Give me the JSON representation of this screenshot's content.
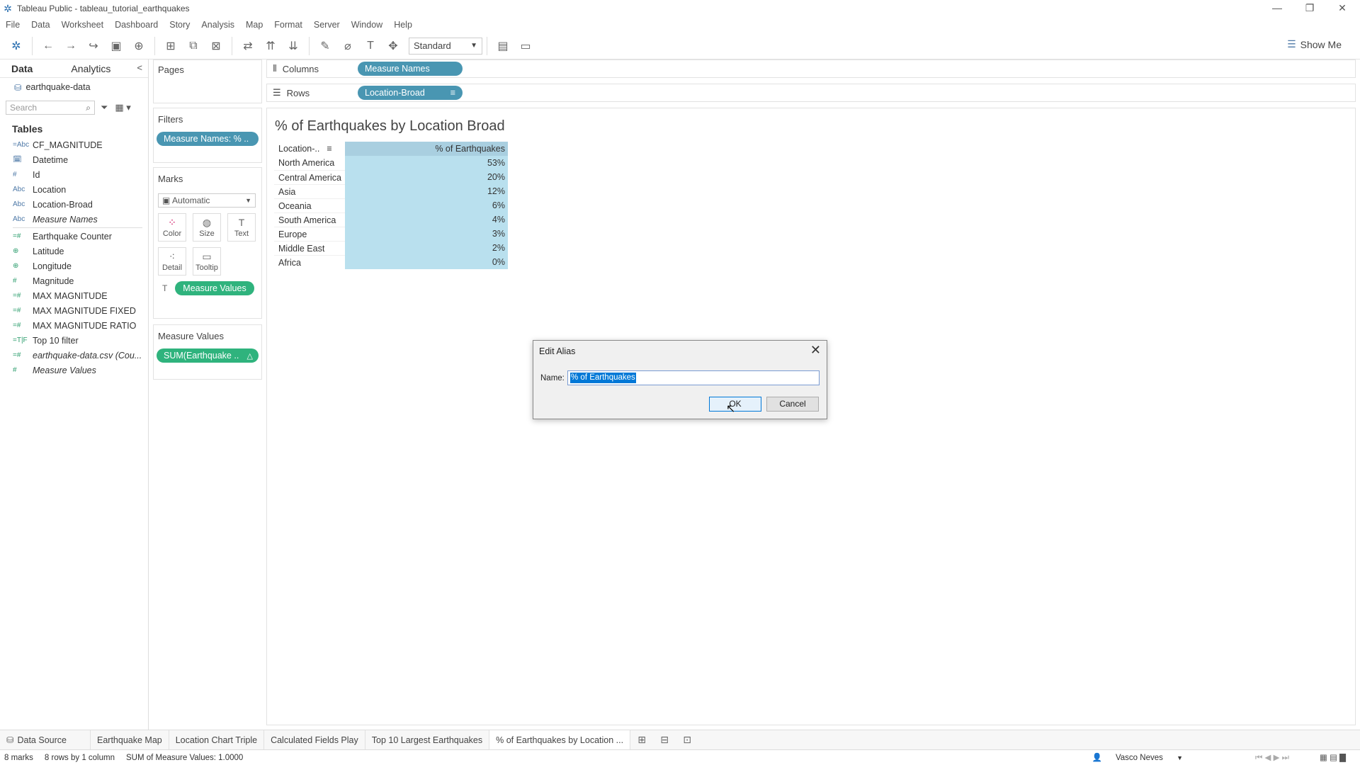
{
  "window": {
    "title": "Tableau Public - tableau_tutorial_earthquakes"
  },
  "menu": [
    "File",
    "Data",
    "Worksheet",
    "Dashboard",
    "Story",
    "Analysis",
    "Map",
    "Format",
    "Server",
    "Window",
    "Help"
  ],
  "toolbar": {
    "fit_label": "Standard",
    "show_me": "Show Me"
  },
  "data_pane": {
    "tab_data": "Data",
    "tab_analytics": "Analytics",
    "datasource": "earthquake-data",
    "search_placeholder": "Search",
    "tables_heading": "Tables",
    "dimensions": [
      {
        "icon": "=Abc",
        "name": "CF_MAGNITUDE",
        "italic": false
      },
      {
        "icon": "calendar",
        "name": "Datetime",
        "italic": false
      },
      {
        "icon": "#",
        "name": "Id",
        "italic": false
      },
      {
        "icon": "Abc",
        "name": "Location",
        "italic": false
      },
      {
        "icon": "Abc",
        "name": "Location-Broad",
        "italic": false
      },
      {
        "icon": "Abc",
        "name": "Measure Names",
        "italic": true
      }
    ],
    "measures": [
      {
        "icon": "=#",
        "name": "Earthquake Counter",
        "italic": false
      },
      {
        "icon": "globe",
        "name": "Latitude",
        "italic": false
      },
      {
        "icon": "globe",
        "name": "Longitude",
        "italic": false
      },
      {
        "icon": "#",
        "name": "Magnitude",
        "italic": false
      },
      {
        "icon": "=#",
        "name": "MAX MAGNITUDE",
        "italic": false
      },
      {
        "icon": "=#",
        "name": "MAX MAGNITUDE FIXED",
        "italic": false
      },
      {
        "icon": "=#",
        "name": "MAX MAGNITUDE RATIO",
        "italic": false
      },
      {
        "icon": "=T|F",
        "name": "Top 10 filter",
        "italic": false
      },
      {
        "icon": "=#",
        "name": "earthquake-data.csv (Cou...",
        "italic": true
      },
      {
        "icon": "#",
        "name": "Measure Values",
        "italic": true
      }
    ]
  },
  "cards": {
    "pages": "Pages",
    "filters": "Filters",
    "filter_pill": "Measure Names: % ..",
    "marks": "Marks",
    "marks_type": "Automatic",
    "mark_buttons": [
      "Color",
      "Size",
      "Text",
      "Detail",
      "Tooltip"
    ],
    "marks_pill": "Measure Values",
    "measure_values": "Measure Values",
    "measure_values_pill": "SUM(Earthquake .."
  },
  "shelves": {
    "columns_label": "Columns",
    "columns_pill": "Measure Names",
    "rows_label": "Rows",
    "rows_pill": "Location-Broad"
  },
  "view": {
    "title": "% of Earthquakes by Location Broad",
    "header": [
      "Location-..",
      "% of Earthquakes"
    ]
  },
  "chart_data": {
    "type": "table",
    "title": "% of Earthquakes by Location Broad",
    "categories": [
      "North America",
      "Central America",
      "Asia",
      "Oceania",
      "South America",
      "Europe",
      "Middle East",
      "Africa"
    ],
    "values": [
      "53%",
      "20%",
      "12%",
      "6%",
      "4%",
      "3%",
      "2%",
      "0%"
    ],
    "xlabel": "% of Earthquakes",
    "ylabel": "Location-.."
  },
  "dialog": {
    "title": "Edit Alias",
    "name_label": "Name:",
    "name_value": "% of Earthquakes",
    "ok": "OK",
    "cancel": "Cancel"
  },
  "sheet_tabs": [
    "Data Source",
    "Earthquake Map",
    "Location Chart Triple",
    "Calculated Fields Play",
    "Top 10 Largest Earthquakes",
    "% of Earthquakes by Location ..."
  ],
  "status": {
    "marks": "8 marks",
    "rows": "8 rows by 1 column",
    "sum": "SUM of Measure Values: 1.0000",
    "user": "Vasco Neves"
  },
  "colors": {
    "blue_pill": "#4996b2",
    "green_pill": "#2fb37d",
    "table_fill": "#b9e0ee"
  }
}
